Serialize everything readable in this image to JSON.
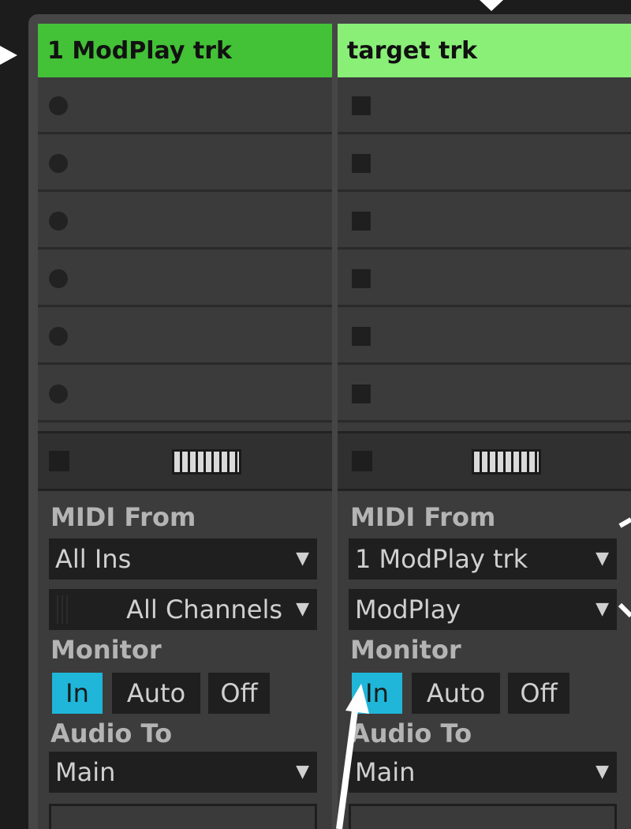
{
  "tracks": [
    {
      "name": "1 ModPlay trk",
      "header_color": "#43c137",
      "slot_marker": "circle",
      "midi_from_label": "MIDI From",
      "midi_from_value": "All Ins",
      "channel_value": "All Channels",
      "monitor_label": "Monitor",
      "monitor_options": [
        "In",
        "Auto",
        "Off"
      ],
      "monitor_selected": "In",
      "audio_to_label": "Audio To",
      "audio_to_value": "Main"
    },
    {
      "name": "target trk",
      "header_color": "#89ef77",
      "slot_marker": "square",
      "midi_from_label": "MIDI From",
      "midi_from_value": "1 ModPlay trk",
      "channel_value": "ModPlay",
      "monitor_label": "Monitor",
      "monitor_options": [
        "In",
        "Auto",
        "Off"
      ],
      "monitor_selected": "In",
      "audio_to_label": "Audio To",
      "audio_to_value": "Main"
    }
  ],
  "colors": {
    "monitor_active": "#1fb6d9",
    "annotation_arrow": "#ffffff"
  },
  "icons": {
    "dropdown": "triangle-down-icon",
    "keyboard": "piano-keyboard-icon"
  }
}
